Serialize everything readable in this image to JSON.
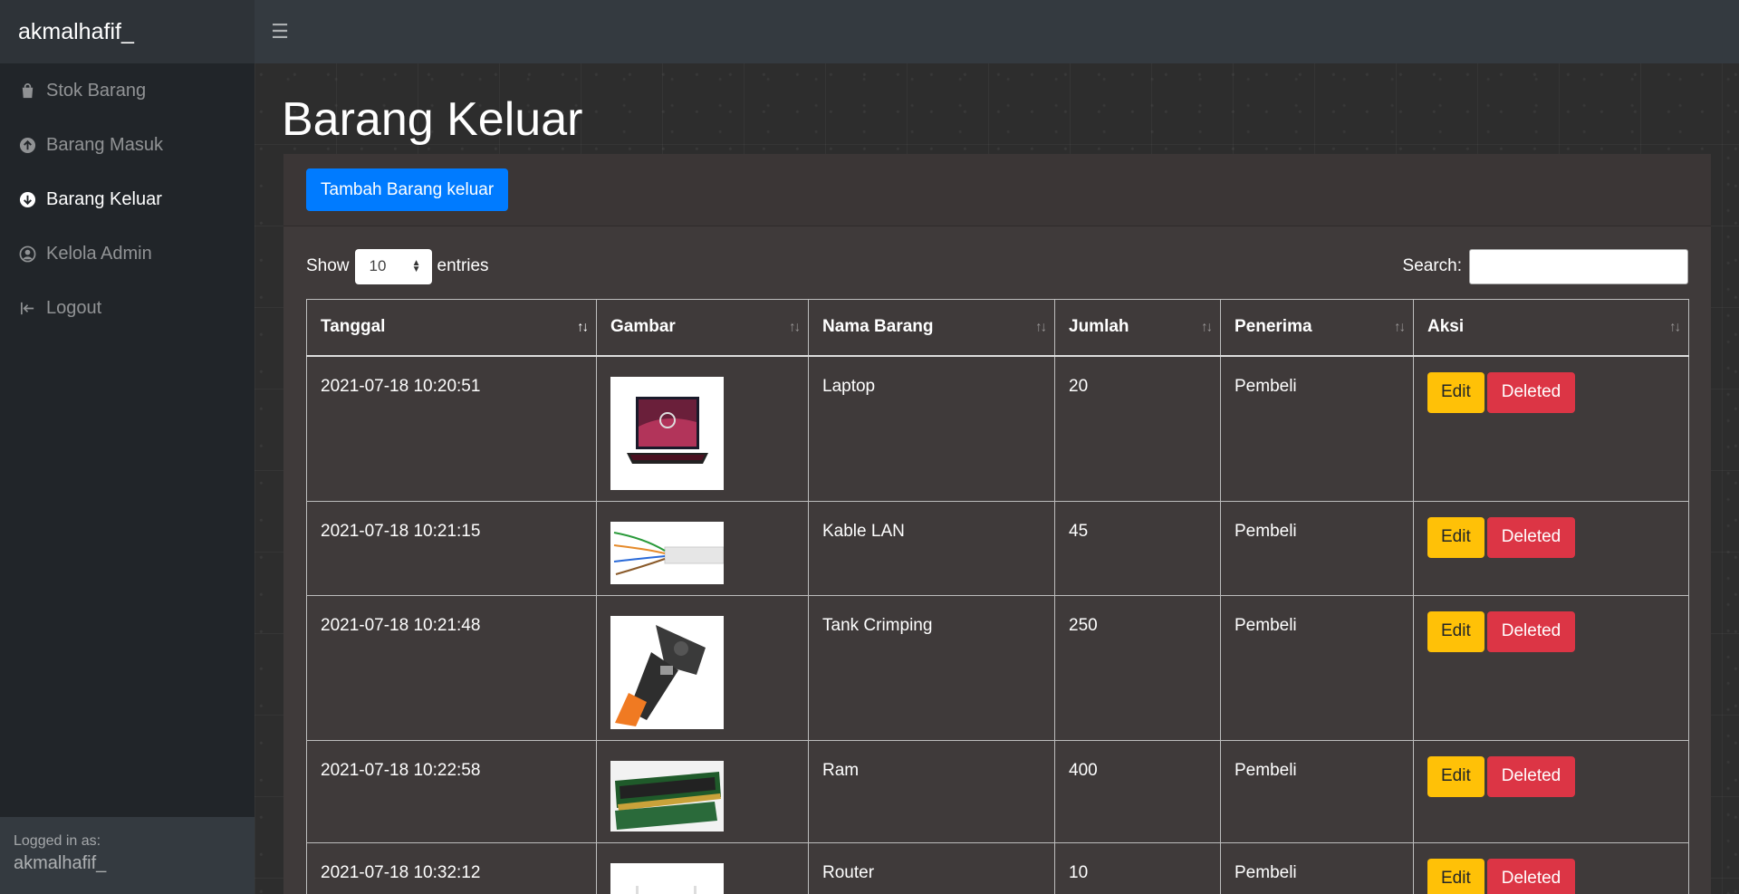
{
  "brand": "akmalhafif_",
  "sidebar": {
    "items": [
      {
        "label": "Stok Barang",
        "icon": "shopping-bag-icon"
      },
      {
        "label": "Barang Masuk",
        "icon": "arrow-circle-up-icon"
      },
      {
        "label": "Barang Keluar",
        "icon": "arrow-circle-down-icon",
        "active": true
      },
      {
        "label": "Kelola Admin",
        "icon": "user-circle-icon"
      },
      {
        "label": "Logout",
        "icon": "sign-out-icon"
      }
    ],
    "footer_label": "Logged in as:",
    "footer_user": "akmalhafif_"
  },
  "page": {
    "title": "Barang Keluar",
    "add_button": "Tambah Barang keluar",
    "show_label": "Show",
    "entries_value": "10",
    "entries_label": "entries",
    "search_label": "Search:",
    "search_value": ""
  },
  "table": {
    "columns": [
      "Tanggal",
      "Gambar",
      "Nama Barang",
      "Jumlah",
      "Penerima",
      "Aksi"
    ],
    "edit_label": "Edit",
    "delete_label": "Deleted",
    "rows": [
      {
        "tanggal": "2021-07-18 10:20:51",
        "image": "laptop",
        "nama": "Laptop",
        "jumlah": "20",
        "penerima": "Pembeli"
      },
      {
        "tanggal": "2021-07-18 10:21:15",
        "image": "lan-cable",
        "nama": "Kable LAN",
        "jumlah": "45",
        "penerima": "Pembeli"
      },
      {
        "tanggal": "2021-07-18 10:21:48",
        "image": "crimping-tool",
        "nama": "Tank Crimping",
        "jumlah": "250",
        "penerima": "Pembeli"
      },
      {
        "tanggal": "2021-07-18 10:22:58",
        "image": "ram",
        "nama": "Ram",
        "jumlah": "400",
        "penerima": "Pembeli"
      },
      {
        "tanggal": "2021-07-18 10:32:12",
        "image": "router",
        "nama": "Router",
        "jumlah": "10",
        "penerima": "Pembeli"
      }
    ]
  },
  "colors": {
    "primary": "#007bff",
    "warning": "#ffc107",
    "danger": "#dc3545"
  }
}
